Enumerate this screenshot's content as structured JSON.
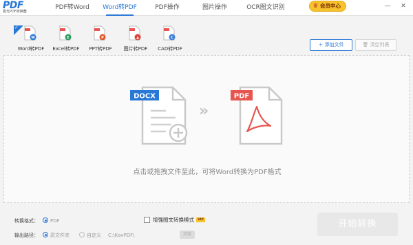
{
  "app": {
    "logo": "PDF",
    "logo_sub": "极光PDF转换器"
  },
  "tabs": [
    {
      "label": "PDF转Word",
      "active": false
    },
    {
      "label": "Word转PDF",
      "active": true
    },
    {
      "label": "PDF操作",
      "active": false
    },
    {
      "label": "图片操作",
      "active": false
    },
    {
      "label": "OCR图文识别",
      "active": false
    }
  ],
  "vip": {
    "label": "会员中心"
  },
  "window_controls": {
    "minimize": "—",
    "close": "✕"
  },
  "formats": [
    {
      "label": "Word转PDF",
      "badge": "W",
      "badge_color": "#2a78d6",
      "selected": true
    },
    {
      "label": "Excel转PDF",
      "badge": "E",
      "badge_color": "#2e9b5f",
      "selected": false
    },
    {
      "label": "PPT转PDF",
      "badge": "P",
      "badge_color": "#e0582c",
      "selected": false
    },
    {
      "label": "图片转PDF",
      "badge": "▲",
      "badge_color": "#d9453a",
      "selected": false
    },
    {
      "label": "CAD转PDF",
      "badge": "C",
      "badge_color": "#3b7dd8",
      "selected": false
    }
  ],
  "actions": {
    "add_files": "添加文件",
    "clear_list": "清空列表"
  },
  "dropzone": {
    "source_badge": "DOCX",
    "target_badge": "PDF",
    "arrow": "»",
    "hint": "点击或拖拽文件至此，可将Word转换为PDF格式"
  },
  "settings": {
    "format_label": "转换格式：",
    "format_value": "PDF",
    "enhance_label": "增强图文转换模式",
    "enhance_tag": "VIP",
    "output_label": "输出路径：",
    "output_same": "原文件夹",
    "output_custom": "自定义",
    "output_path": "C:\\KavPDF\\",
    "browse_label": "浏览"
  },
  "start_button": "开始转换",
  "colors": {
    "accent": "#2a78d6",
    "vip": "#f7c32c",
    "pdf_red": "#e8554e",
    "placeholder_doc": "#c9c9c9"
  }
}
